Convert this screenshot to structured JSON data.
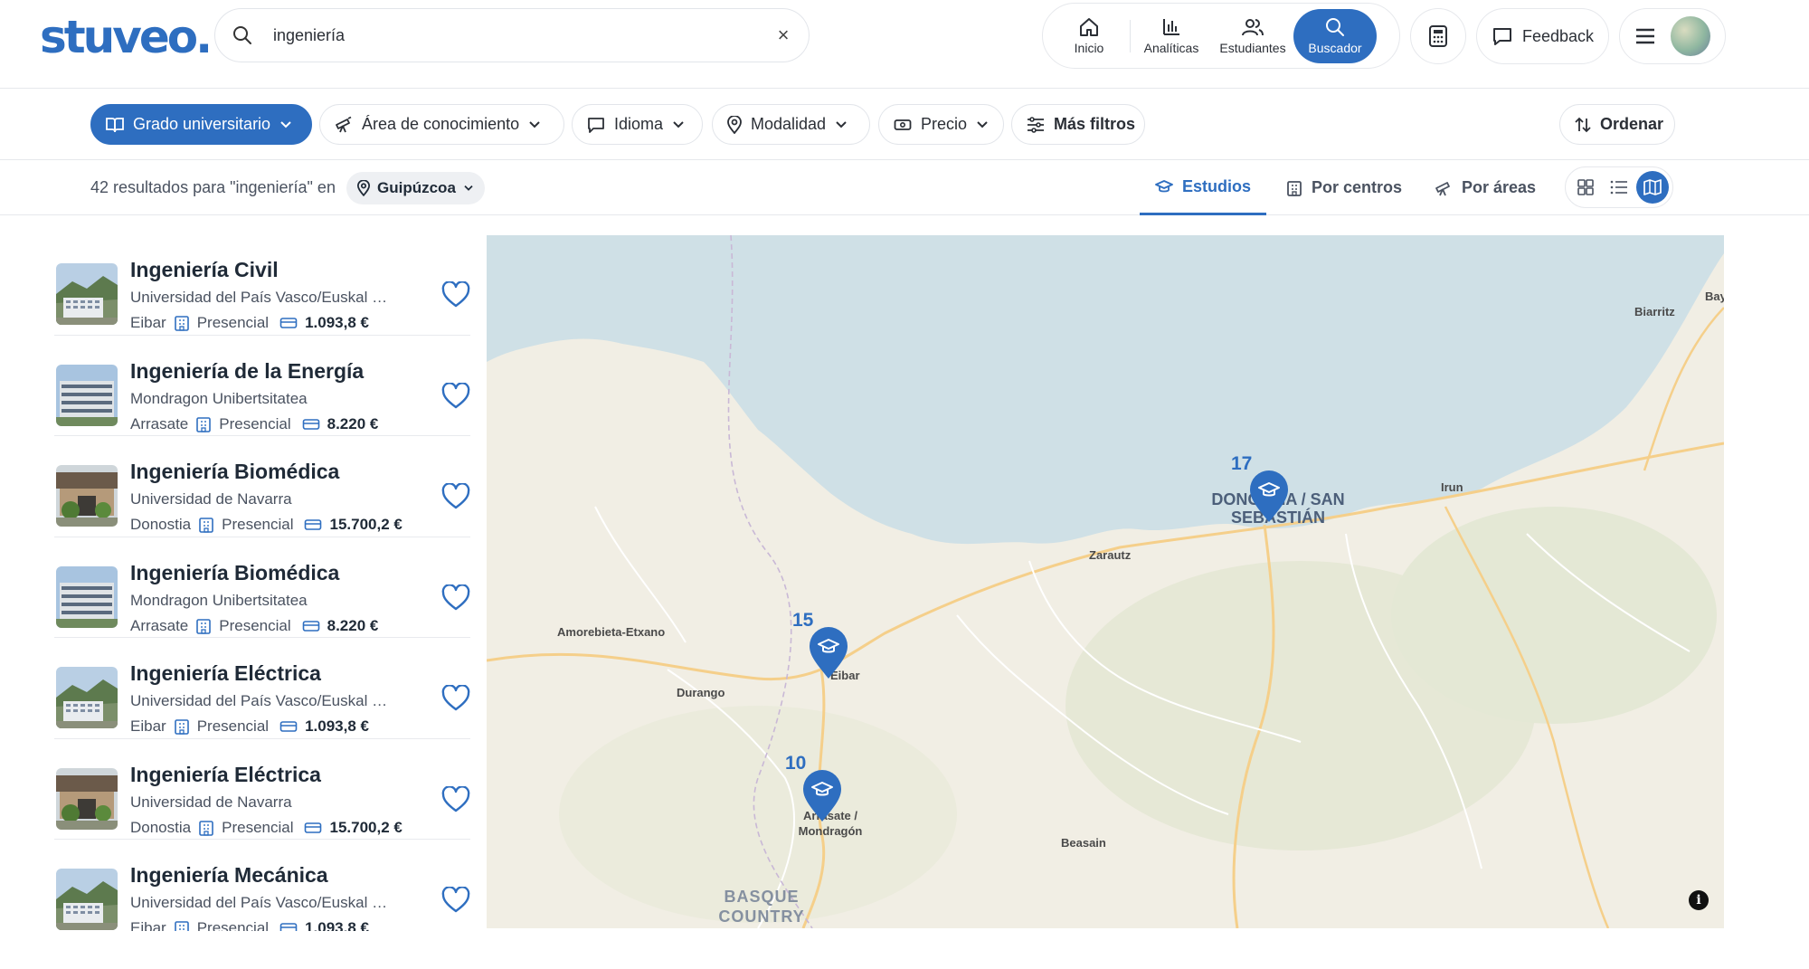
{
  "header": {
    "logo": "stuveo.",
    "search": {
      "value": "ingeniería",
      "clear_label": "×"
    },
    "nav": [
      {
        "label": "Inicio",
        "icon": "home-icon"
      },
      {
        "label": "Analíticas",
        "icon": "bar-chart-icon"
      },
      {
        "label": "Estudiantes",
        "icon": "users-icon"
      },
      {
        "label": "Buscador",
        "icon": "search-icon",
        "active": true
      }
    ],
    "calculator_icon": "calculator-icon",
    "feedback_label": "Feedback",
    "menu_icon": "hamburger-menu-icon"
  },
  "filters": {
    "grado": "Grado universitario",
    "area": "Área de conocimiento",
    "idioma": "Idioma",
    "modalidad": "Modalidad",
    "precio": "Precio",
    "mas_filtros": "Más filtros",
    "ordenar": "Ordenar"
  },
  "results": {
    "count_text": "42 resultados para \"ingeniería\" en",
    "location": "Guipúzcoa",
    "tabs": {
      "estudios": "Estudios",
      "centros": "Por centros",
      "areas": "Por áreas"
    }
  },
  "items": [
    {
      "title": "Ingeniería Civil",
      "university": "Universidad del País Vasco/Euskal Herriko Unibertsitatea",
      "city": "Eibar",
      "modality": "Presencial",
      "price": "1.093,8 €",
      "thumb": "mountain"
    },
    {
      "title": "Ingeniería de la Energía",
      "university": "Mondragon Unibertsitatea",
      "city": "Arrasate",
      "modality": "Presencial",
      "price": "8.220 €",
      "thumb": "building"
    },
    {
      "title": "Ingeniería Biomédica",
      "university": "Universidad de Navarra",
      "city": "Donostia",
      "modality": "Presencial",
      "price": "15.700,2 €",
      "thumb": "tecnun"
    },
    {
      "title": "Ingeniería Biomédica",
      "university": "Mondragon Unibertsitatea",
      "city": "Arrasate",
      "modality": "Presencial",
      "price": "8.220 €",
      "thumb": "building"
    },
    {
      "title": "Ingeniería Eléctrica",
      "university": "Universidad del País Vasco/Euskal Herriko Unibertsitatea",
      "city": "Eibar",
      "modality": "Presencial",
      "price": "1.093,8 €",
      "thumb": "mountain"
    },
    {
      "title": "Ingeniería Eléctrica",
      "university": "Universidad de Navarra",
      "city": "Donostia",
      "modality": "Presencial",
      "price": "15.700,2 €",
      "thumb": "tecnun"
    },
    {
      "title": "Ingeniería Mecánica",
      "university": "Universidad del País Vasco/Euskal Herriko Unibertsitatea",
      "city": "Eibar",
      "modality": "Presencial",
      "price": "1.093,8 €",
      "thumb": "mountain"
    }
  ],
  "map": {
    "labels": {
      "biarritz": "Biarritz",
      "bay": "Bay",
      "irun": "Irun",
      "zarautz": "Zarautz",
      "amorebieta": "Amorebieta-Etxano",
      "durango": "Durango",
      "eibar": "Eibar",
      "beasain": "Beasain",
      "donostia": "DONOSTIA / SAN SEBASTIÁN",
      "arrasate": "Arrasate / Mondragón",
      "region": "BASQUE COUNTRY"
    },
    "clusters": {
      "donostia": "17",
      "eibar": "15",
      "arrasate": "10"
    },
    "info": "i"
  },
  "colors": {
    "accent": "#2e6ec0",
    "sea": "#cfe0e6",
    "land": "#f1eee4"
  }
}
